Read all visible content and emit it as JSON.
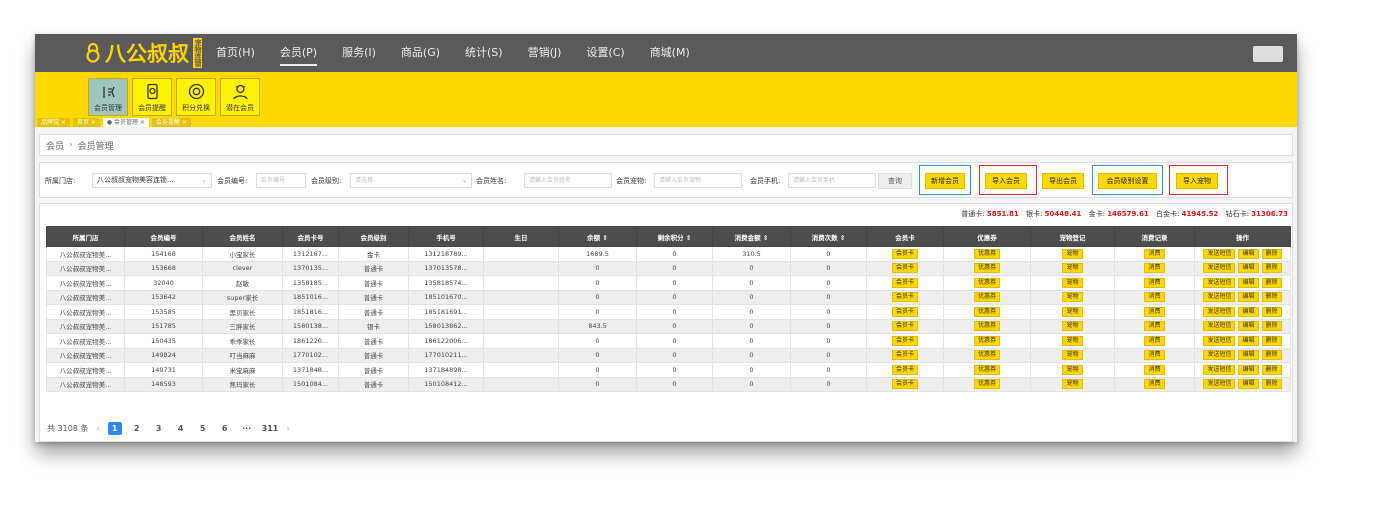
{
  "app": {
    "logo_text": "八公叔叔",
    "logo_badge": "宠物连锁"
  },
  "main_nav": [
    {
      "label": "首页(H)",
      "active": false
    },
    {
      "label": "会员(P)",
      "active": true
    },
    {
      "label": "服务(I)",
      "active": false
    },
    {
      "label": "商品(G)",
      "active": false
    },
    {
      "label": "统计(S)",
      "active": false
    },
    {
      "label": "营销(J)",
      "active": false
    },
    {
      "label": "设置(C)",
      "active": false
    },
    {
      "label": "商城(M)",
      "active": false
    }
  ],
  "sub_nav": [
    {
      "label": "会员管理",
      "icon": "member-icon",
      "active": true
    },
    {
      "label": "会员提醒",
      "icon": "phone-reminder-icon",
      "active": false
    },
    {
      "label": "积分兑换",
      "icon": "points-exchange-icon",
      "active": false
    },
    {
      "label": "潜在会员",
      "icon": "potential-member-icon",
      "active": false
    }
  ],
  "tabs": [
    {
      "label": "品牌馆 ×",
      "active": false
    },
    {
      "label": "首页 ×",
      "active": false
    },
    {
      "label": "● 会员管理 ×",
      "active": true
    },
    {
      "label": "会员提醒 ×",
      "active": false
    }
  ],
  "breadcrumb": {
    "root": "会员",
    "sep": "›",
    "current": "会员管理"
  },
  "filters": {
    "store_label": "所属门店:",
    "store_value": "八公叔叔宠物美容连锁...",
    "member_no_label": "会员编号:",
    "member_no_placeholder": "会员编号",
    "level_label": "会员级别:",
    "level_placeholder": "请选择",
    "name_label": "会员姓名:",
    "name_placeholder": "请输入会员姓名",
    "pet_label": "会员宠物:",
    "pet_placeholder": "请输入会员宠物",
    "phone_label": "会员手机:",
    "phone_placeholder": "请输入会员手机",
    "query_button": "查询"
  },
  "actions": {
    "add": "新增会员",
    "import": "导入会员",
    "export": "导出会员",
    "level_setting": "会员级别设置",
    "import_pet": "导入宠物"
  },
  "stats": {
    "normal_label": "普通卡:",
    "normal": "5851.81",
    "silver_label": "银卡:",
    "silver": "50448.41",
    "gold_label": "金卡:",
    "gold": "146579.61",
    "platinum_label": "白金卡:",
    "platinum": "41945.52",
    "diamond_label": "钻石卡:",
    "diamond": "31306.73"
  },
  "columns": [
    "所属门店",
    "会员编号",
    "会员姓名",
    "会员卡号",
    "会员级别",
    "手机号",
    "生日",
    "余额 ⇕",
    "剩余积分 ⇕",
    "消费金额 ⇕",
    "消费次数 ⇕",
    "会员卡",
    "优惠券",
    "宠物登记",
    "消费记录",
    "操作"
  ],
  "row_buttons": {
    "card": "会员卡",
    "coupon": "优惠券",
    "pet": "宠物",
    "consume": "消费",
    "sms": "发送短信",
    "edit": "编辑",
    "delete": "删除"
  },
  "rows": [
    {
      "store": "八公叔叔宠物美...",
      "no": "154168",
      "name": "小宝家长",
      "card": "1312187...",
      "level": "金卡",
      "phone": "131218789...",
      "birthday": "",
      "balance": "1689.5",
      "points": "0",
      "amount": "310.5",
      "times": "0"
    },
    {
      "store": "八公叔叔宠物美...",
      "no": "153668",
      "name": "clever",
      "card": "1370135...",
      "level": "普通卡",
      "phone": "137013578...",
      "birthday": "",
      "balance": "0",
      "points": "0",
      "amount": "0",
      "times": "0"
    },
    {
      "store": "八公叔叔宠物美...",
      "no": "32040",
      "name": "赵敏",
      "card": "1358185...",
      "level": "普通卡",
      "phone": "135818574...",
      "birthday": "",
      "balance": "0",
      "points": "0",
      "amount": "0",
      "times": "0"
    },
    {
      "store": "八公叔叔宠物美...",
      "no": "153642",
      "name": "super家长",
      "card": "1851016...",
      "level": "普通卡",
      "phone": "185101670...",
      "birthday": "",
      "balance": "0",
      "points": "0",
      "amount": "0",
      "times": "0"
    },
    {
      "store": "八公叔叔宠物美...",
      "no": "153585",
      "name": "黑贝家长",
      "card": "1851816...",
      "level": "普通卡",
      "phone": "185181691...",
      "birthday": "",
      "balance": "0",
      "points": "0",
      "amount": "0",
      "times": "0"
    },
    {
      "store": "八公叔叔宠物美...",
      "no": "151785",
      "name": "三胖家长",
      "card": "1580138...",
      "level": "银卡",
      "phone": "158013862...",
      "birthday": "",
      "balance": "843.5",
      "points": "0",
      "amount": "0",
      "times": "0"
    },
    {
      "store": "八公叔叔宠物美...",
      "no": "150435",
      "name": "乖乖家长",
      "card": "1861220...",
      "level": "普通卡",
      "phone": "186122006...",
      "birthday": "",
      "balance": "0",
      "points": "0",
      "amount": "0",
      "times": "0"
    },
    {
      "store": "八公叔叔宠物美...",
      "no": "149824",
      "name": "叮当麻麻",
      "card": "1770102...",
      "level": "普通卡",
      "phone": "177010211...",
      "birthday": "",
      "balance": "0",
      "points": "0",
      "amount": "0",
      "times": "0"
    },
    {
      "store": "八公叔叔宠物美...",
      "no": "149731",
      "name": "米宝麻麻",
      "card": "1371848...",
      "level": "普通卡",
      "phone": "137184898...",
      "birthday": "",
      "balance": "0",
      "points": "0",
      "amount": "0",
      "times": "0"
    },
    {
      "store": "八公叔叔宠物美...",
      "no": "148593",
      "name": "焦玛家长",
      "card": "1501084...",
      "level": "普通卡",
      "phone": "150108412...",
      "birthday": "",
      "balance": "0",
      "points": "0",
      "amount": "0",
      "times": "0"
    }
  ],
  "pagination": {
    "total": "共 3108 条",
    "prev": "‹",
    "pages": [
      "1",
      "2",
      "3",
      "4",
      "5",
      "6",
      "···",
      "311"
    ],
    "current": "1",
    "next": "›"
  },
  "colors": {
    "brand_yellow": "#ffd800",
    "topbar": "#5a5a5a",
    "header_dark": "#4d4d4d",
    "highlight_red": "#e52727",
    "highlight_blue": "#3d8ee0",
    "page_active": "#2f88f0"
  }
}
